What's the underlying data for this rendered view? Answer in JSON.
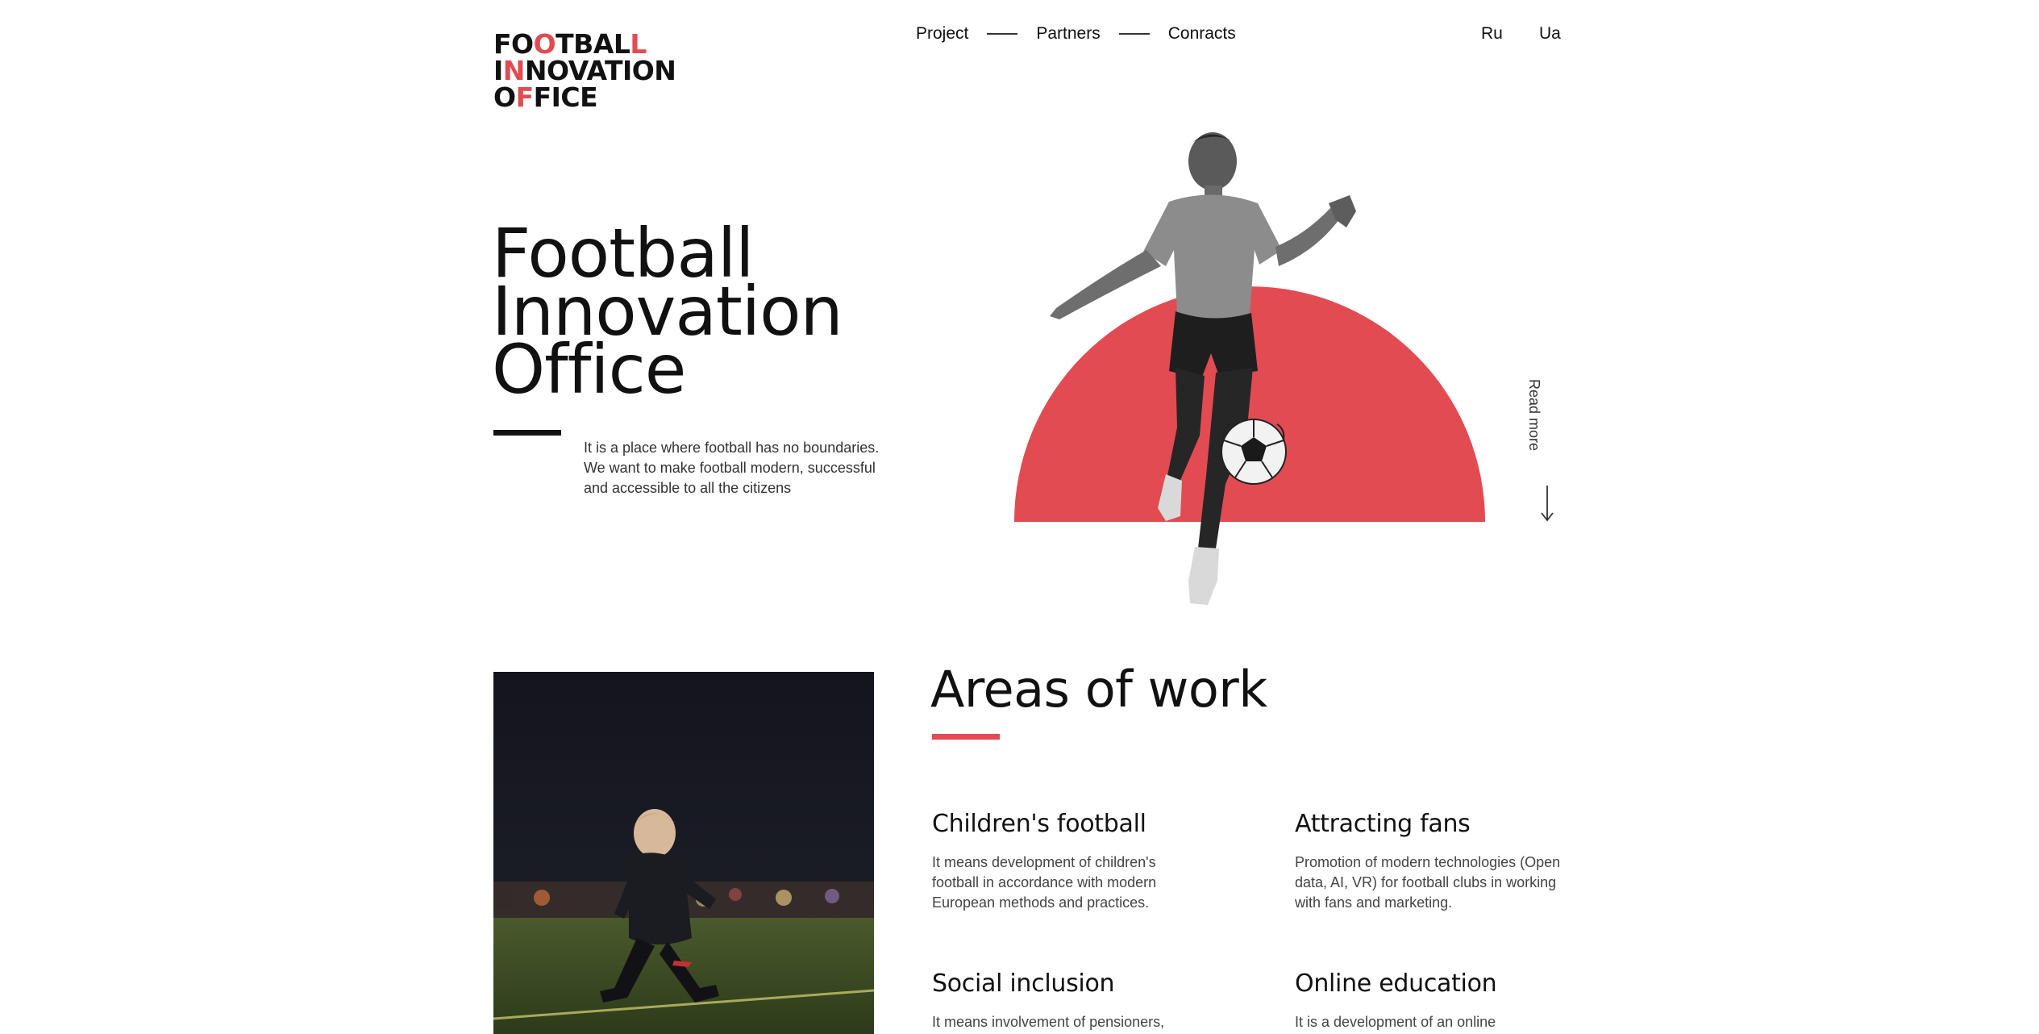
{
  "logo": {
    "line1": [
      "FO",
      "O",
      "TBAL",
      "L"
    ],
    "line2": [
      "I",
      "N",
      "NOVATION"
    ],
    "line3": [
      "O",
      "F",
      "FICE"
    ]
  },
  "nav": {
    "items": [
      {
        "label": "Project"
      },
      {
        "label": "Partners"
      },
      {
        "label": "Conracts"
      }
    ]
  },
  "languages": [
    "Ru",
    "Ua"
  ],
  "hero": {
    "title_lines": [
      "Football",
      "Innovation",
      "Office"
    ],
    "description": "It is a place where football has no boundaries. We want to make football modern, successful and accessible to all the citizens",
    "read_more": "Read more"
  },
  "areas": {
    "title": "Areas of work",
    "items": [
      {
        "title": "Children's football",
        "text": "It means development of children's football in accordance with modern European methods and practices."
      },
      {
        "title": "Attracting fans",
        "text": "Promotion of modern technologies (Open data, AI, VR) for football clubs in working with fans and marketing."
      },
      {
        "title": "Social inclusion",
        "text": "It means involvement of pensioners,"
      },
      {
        "title": "Online education",
        "text": "It is a development of an online"
      }
    ]
  },
  "colors": {
    "accent": "#e24b52",
    "text": "#111111",
    "muted": "#444444",
    "background": "#ffffff"
  }
}
